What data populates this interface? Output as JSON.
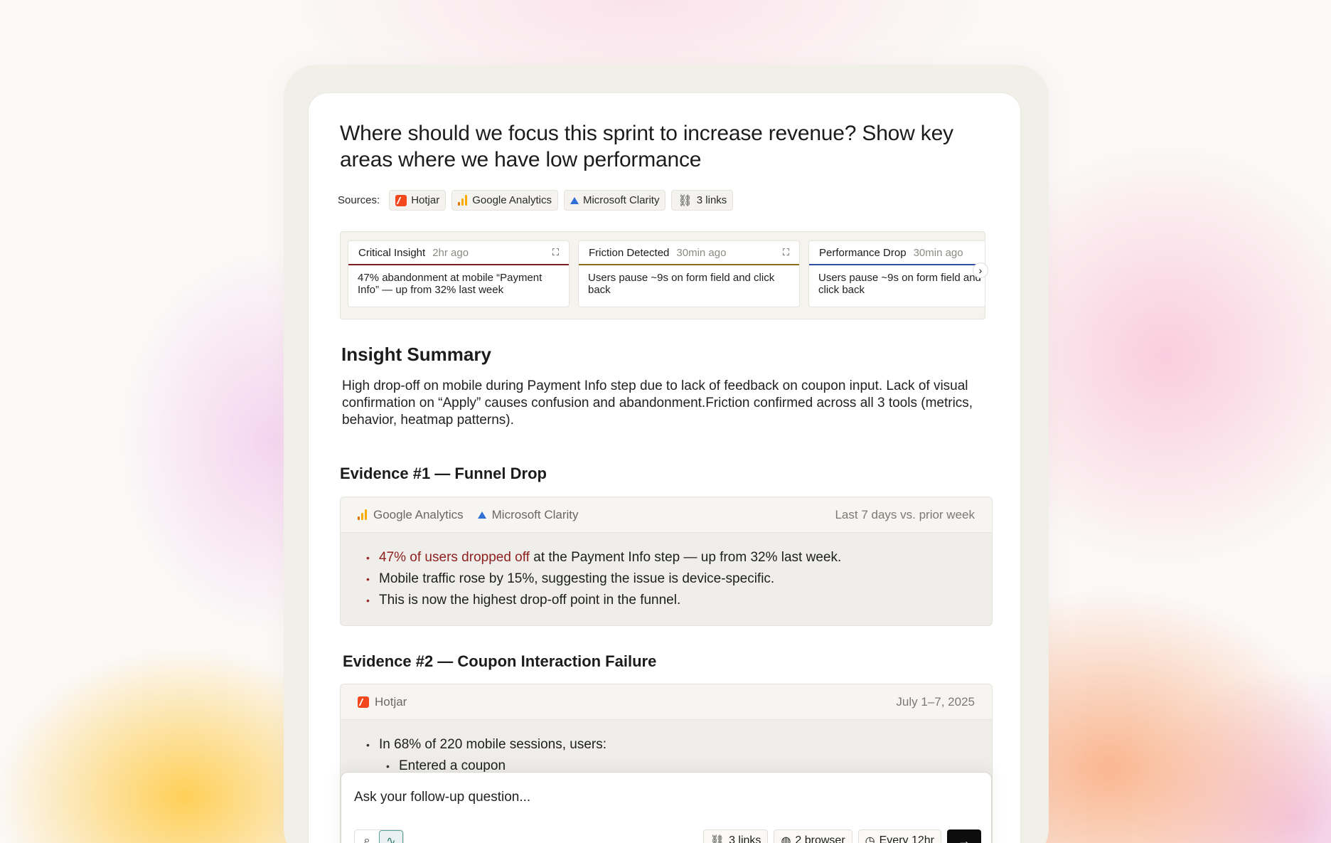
{
  "question": "Where should we focus this sprint to increase revenue? Show key areas where we have low performance",
  "sources": {
    "label": "Sources:",
    "items": [
      {
        "name": "Hotjar",
        "icon": "hotjar-icon"
      },
      {
        "name": "Google Analytics",
        "icon": "google-analytics-icon"
      },
      {
        "name": "Microsoft Clarity",
        "icon": "microsoft-clarity-icon"
      },
      {
        "name": "3 links",
        "icon": "link-icon"
      }
    ]
  },
  "insights": [
    {
      "title": "Critical Insight",
      "time": "2hr ago",
      "body": "47% abandonment at mobile “Payment Info” — up from 32% last week",
      "accent": "#7a1e1e"
    },
    {
      "title": "Friction Detected",
      "time": "30min ago",
      "body": "Users pause ~9s on form field and click back",
      "accent": "#8a6d1a"
    },
    {
      "title": "Performance Drop",
      "time": "30min ago",
      "body": "Users pause ~9s on form field and click back",
      "accent": "#2f4fa3"
    }
  ],
  "summary": {
    "title": "Insight Summary",
    "text": "High drop-off on mobile during Payment Info step due to lack of feedback on coupon input. Lack of visual confirmation on “Apply” causes confusion and abandonment.Friction confirmed across all 3 tools (metrics, behavior, heatmap patterns)."
  },
  "evidence1": {
    "title": "Evidence #1 — Funnel Drop",
    "source1": "Google Analytics",
    "source2": "Microsoft Clarity",
    "range": "Last 7 days vs. prior week",
    "bullet1_highlight": "47% of users dropped off",
    "bullet1_rest": " at the Payment Info step — up from 32% last week.",
    "bullet2": "Mobile traffic rose by 15%, suggesting the issue is device-specific.",
    "bullet3": "This is now the highest drop-off point in the funnel."
  },
  "evidence2": {
    "title": "Evidence #2 — Coupon Interaction Failure",
    "source": "Hotjar",
    "range": "July 1–7, 2025",
    "bullet1": "In 68% of 220 mobile sessions, users:",
    "sub1": "Entered a coupon"
  },
  "ask": {
    "placeholder": "Ask your follow-up question...",
    "links": "3 links",
    "browser": "2 browser",
    "schedule": "Every 12hr"
  },
  "colors": {
    "highlight": "#8f1f1f",
    "hotjar": "#f2471c",
    "clarity": "#2f6fd6",
    "ga": "#f9ab00"
  }
}
